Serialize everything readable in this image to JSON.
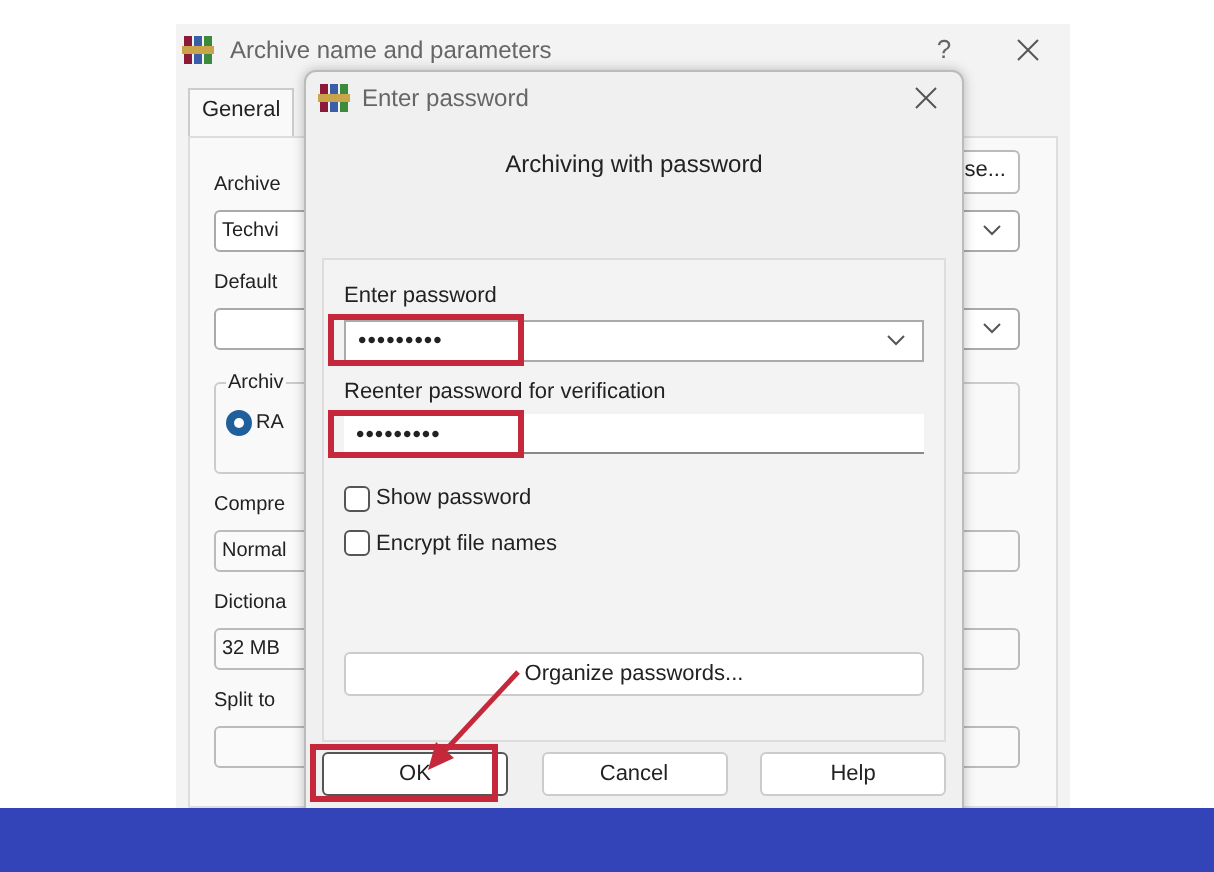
{
  "back_window": {
    "title": "Archive name and parameters",
    "help": "?",
    "tabs": [
      {
        "label": "General",
        "selected": true
      }
    ],
    "browse_button": "se...",
    "fields": [
      {
        "kind": "label",
        "text": "Archive"
      },
      {
        "kind": "combo",
        "value": "Techvi"
      },
      {
        "kind": "label",
        "text": "Default"
      },
      {
        "kind": "combo"
      },
      {
        "kind": "group",
        "title": "Archiv",
        "radio": {
          "label": "RA",
          "selected": true
        }
      },
      {
        "kind": "label",
        "text": "Compre"
      },
      {
        "kind": "box",
        "value": "Normal"
      },
      {
        "kind": "label",
        "text": "Dictiona"
      },
      {
        "kind": "box",
        "value": "32 MB"
      },
      {
        "kind": "label",
        "text": "Split to"
      },
      {
        "kind": "box"
      }
    ]
  },
  "dialog": {
    "title": "Enter password",
    "heading": "Archiving with password",
    "password_label": "Enter password",
    "password": "•••••••••",
    "reenter_label": "Reenter password for verification",
    "reenter": "•••••••••",
    "options": [
      {
        "label": "Show password",
        "checked": false
      },
      {
        "label": "Encrypt file names",
        "checked": false
      }
    ],
    "organize_button": "Organize passwords...",
    "buttons": [
      {
        "label": "OK",
        "selected": true
      },
      {
        "label": "Cancel",
        "selected": false
      },
      {
        "label": "Help",
        "selected": false
      }
    ]
  }
}
